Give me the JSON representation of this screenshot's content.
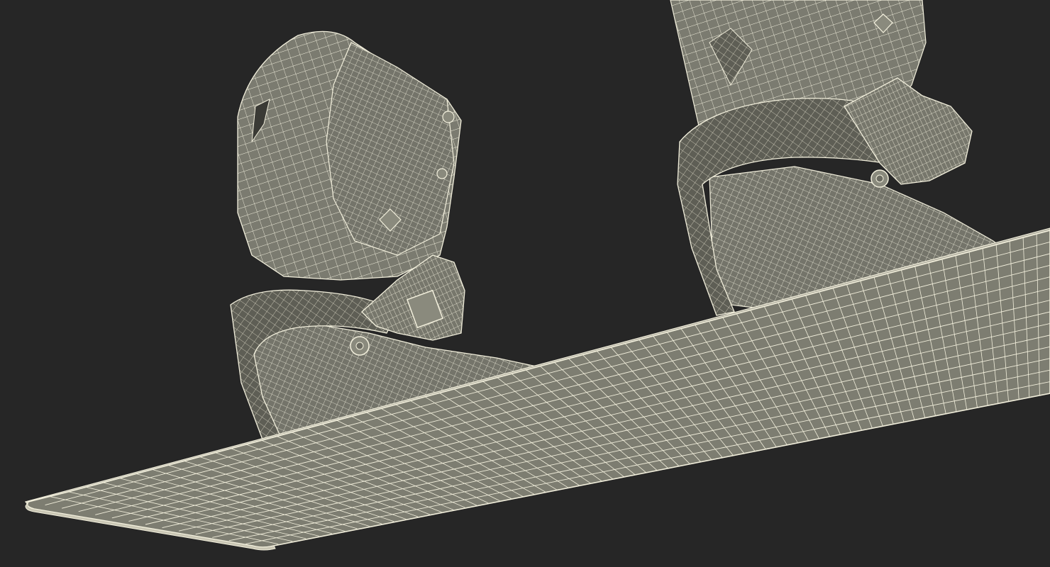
{
  "scene": {
    "subject": "snowboard-boots-wireframe-render",
    "colors": {
      "background": "#262626",
      "mesh_fill": "#7e7e72",
      "mesh_fill_dark": "#5f5f56",
      "mesh_fill_shadow": "#4a4a43",
      "wire_line": "#f2efdc",
      "wire_line_soft": "#d9d6c4"
    },
    "objects": [
      {
        "name": "snowboard-deck",
        "shading": "wireframe"
      },
      {
        "name": "left-boot",
        "shading": "wireframe"
      },
      {
        "name": "right-boot",
        "shading": "wireframe"
      }
    ]
  }
}
